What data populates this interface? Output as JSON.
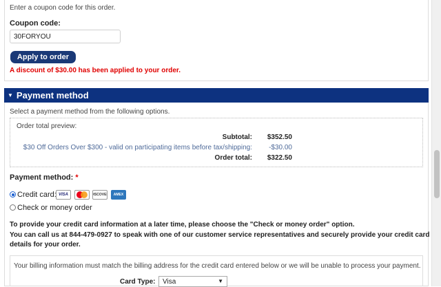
{
  "coupon": {
    "intro": "Enter a coupon code for this order.",
    "label": "Coupon code:",
    "value": "30FORYOU",
    "apply_label": "Apply to order",
    "discount_message": "A discount of $30.00 has been applied to your order."
  },
  "payment": {
    "header": "Payment method",
    "intro": "Select a payment method from the following options.",
    "preview": {
      "title": "Order total preview:",
      "subtotal_label": "Subtotal:",
      "subtotal_value": "$352.50",
      "promo_label": "$30 Off Orders Over $300 - valid on participating items before tax/shipping:",
      "promo_value": "-$30.00",
      "total_label": "Order total:",
      "total_value": "$322.50"
    },
    "method_label": "Payment method:",
    "required_mark": "*",
    "options": [
      {
        "label": "Credit card:",
        "selected": true
      },
      {
        "label": "Check or money order",
        "selected": false
      }
    ],
    "card_logos": [
      "VISA",
      "DISCOVER",
      "AMEX"
    ],
    "info_lines": [
      "To provide your credit card information at a later time, please choose the \"Check or money order\" option.",
      "You can call us at 844-479-0927 to speak with one of our customer service representatives and securely provide your credit card",
      "details for your order."
    ],
    "billing_note": "Your billing information must match the billing address for the credit card entered below or we will be unable to process your payment.",
    "card_type_label": "Card Type:",
    "card_type_value": "Visa"
  },
  "colors": {
    "header_bg": "#0d3280",
    "button_bg": "#1a3977",
    "error_red": "#e00000",
    "promo_blue": "#4e6a99"
  }
}
